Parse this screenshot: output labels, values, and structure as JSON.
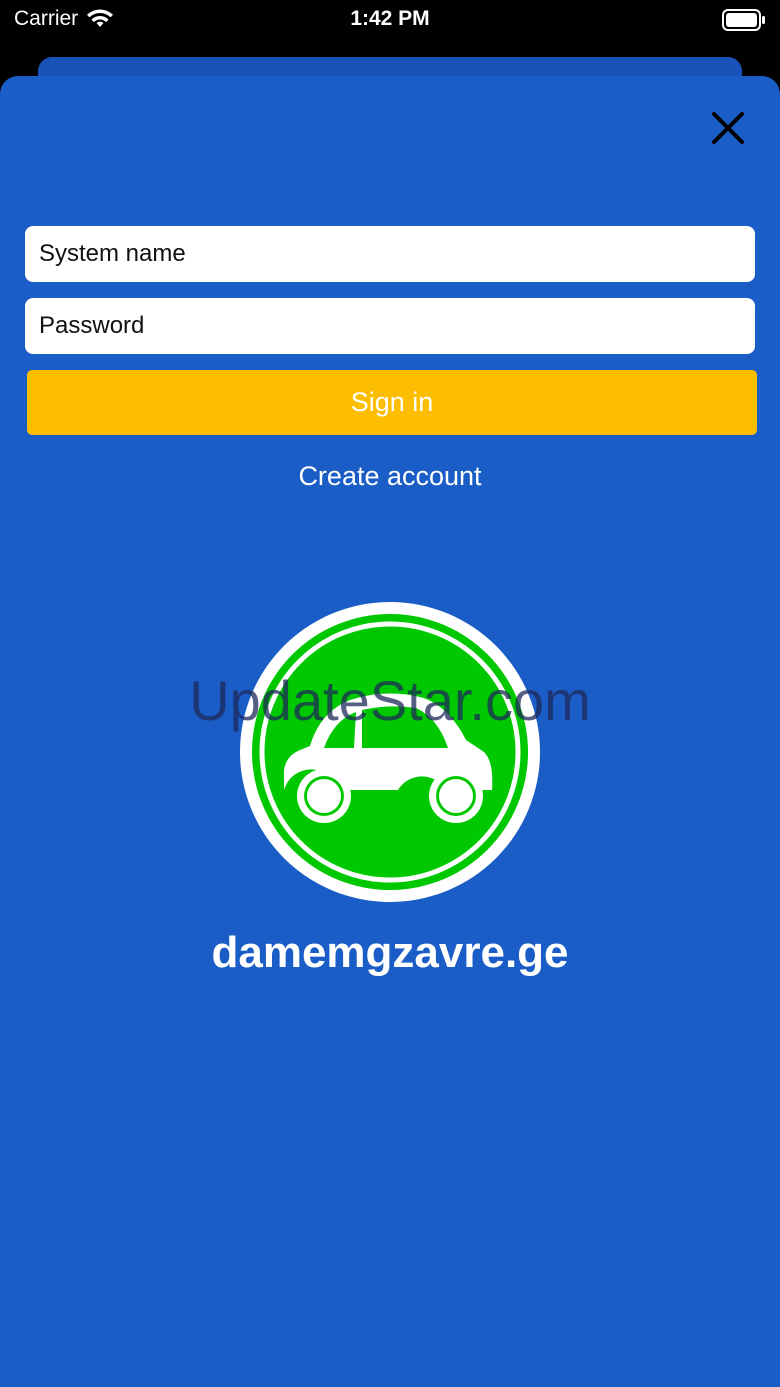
{
  "status_bar": {
    "carrier": "Carrier",
    "time": "1:42 PM"
  },
  "login": {
    "system_name_placeholder": "System name",
    "password_placeholder": "Password",
    "sign_in_label": "Sign in",
    "create_account_label": "Create account"
  },
  "brand": {
    "logo_icon": "car-icon",
    "name": "damemgzavre.ge"
  },
  "watermark": "UpdateStar.com",
  "colors": {
    "background": "#1b5dc6",
    "button": "#fdbd00",
    "logo_green": "#00c800"
  }
}
